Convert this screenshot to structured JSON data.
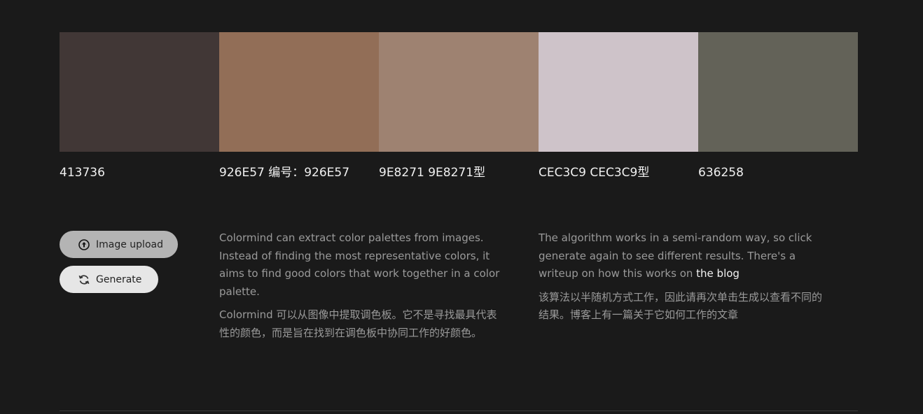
{
  "palette": [
    {
      "hex": "#413736",
      "label": "413736"
    },
    {
      "hex": "#926E57",
      "label": "926E57 编号：926E57"
    },
    {
      "hex": "#9E8271",
      "label": "9E8271 9E8271型"
    },
    {
      "hex": "#CEC3C9",
      "label": "CEC3C9 CEC3C9型"
    },
    {
      "hex": "#636258",
      "label": "636258"
    }
  ],
  "actions": {
    "upload_label": "Image upload",
    "upload_icon": "upload-circle-icon",
    "generate_label": "Generate",
    "generate_icon": "refresh-icon"
  },
  "description_left": {
    "en": "Colormind can extract color palettes from images. Instead of finding the most representative colors, it aims to find good colors that work together in a color palette.",
    "zh": "Colormind 可以从图像中提取调色板。它不是寻找最具代表性的颜色，而是旨在找到在调色板中协同工作的好颜色。"
  },
  "description_right": {
    "en_prefix": "The algorithm works in a semi-random way, so click generate again to see different results. There's a writeup on how this works on ",
    "link_text": "the blog",
    "zh": "该算法以半随机方式工作，因此请再次单击生成以查看不同的结果。博客上有一篇关于它如何工作的文章"
  },
  "colors": {
    "background": "#1a1a1a",
    "upload_button": "#b4b4b4",
    "generate_button": "#e6e6e6"
  }
}
